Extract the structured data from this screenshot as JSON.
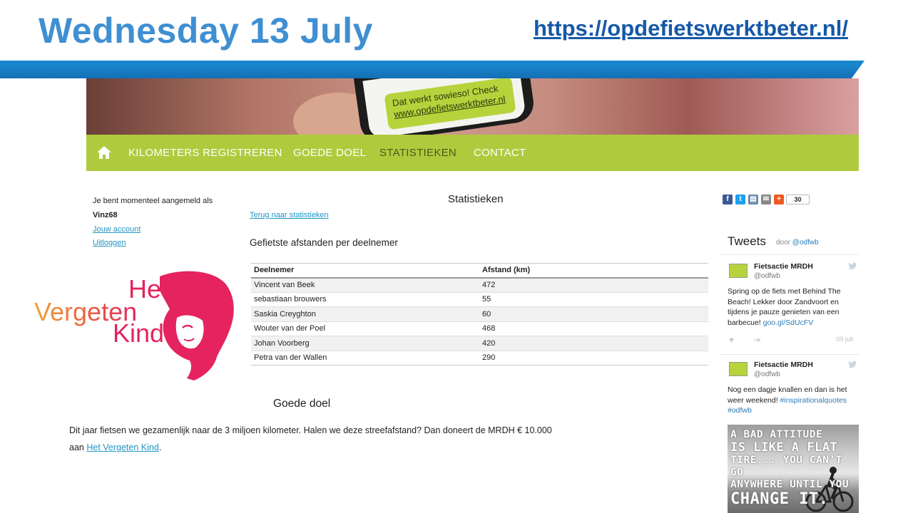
{
  "slide": {
    "title": "Wednesday 13 July",
    "url": "https://opdefietswerktbeter.nl/"
  },
  "hero": {
    "bubble_line1": "Dat werkt sowieso! Check",
    "bubble_line2": "www.opdefietswerktbeter.nl"
  },
  "nav": {
    "items": [
      "KILOMETERS REGISTREREN",
      "GOEDE DOEL",
      "STATISTIEKEN",
      "CONTACT"
    ],
    "active": "STATISTIEKEN"
  },
  "login": {
    "text": "Je bent momenteel aangemeld als",
    "user": "Vinz68",
    "account_link": "Jouw account",
    "logout_link": "Uitloggen"
  },
  "logo": {
    "line1": "Het",
    "line2": "Vergeten",
    "line3": "Kind"
  },
  "stats": {
    "title": "Statistieken",
    "back_link": "Terug naar statistieken",
    "subtitle": "Gefietste afstanden per deelnemer",
    "headers": [
      "Deelnemer",
      "Afstand (km)"
    ],
    "rows": [
      [
        "Vincent van Beek",
        "472"
      ],
      [
        "sebastiaan brouwers",
        "55"
      ],
      [
        "Saskia Creyghton",
        "60"
      ],
      [
        "Wouter van der Poel",
        "468"
      ],
      [
        "Johan Voorberg",
        "420"
      ],
      [
        "Petra van der Wallen",
        "290"
      ]
    ]
  },
  "goal": {
    "title": "Goede doel",
    "text_part1": "Dit jaar fietsen we gezamenlijk naar de 3 miljoen kilometer. Halen we deze streefafstand? Dan doneert de MRDH € 10.000 aan ",
    "link": "Het Vergeten Kind",
    "text_part2": "."
  },
  "share": {
    "count": "30",
    "colors": {
      "facebook": "#3b5998",
      "twitter": "#1da1f2",
      "print": "#6d8aa6",
      "email": "#888888",
      "plus": "#ee5a24"
    }
  },
  "tweets": {
    "title": "Tweets",
    "by_prefix": "door",
    "by_handle": "@odfwb",
    "items": [
      {
        "name": "Fietsactie MRDH",
        "handle": "@odfwb",
        "text": "Spring op de fiets met Behind The Beach! Lekker door Zandvoort en tijdens je pauze genieten van een barbecue!",
        "link": "goo.gl/SdUcFV",
        "date": "09 juli"
      },
      {
        "name": "Fietsactie MRDH",
        "handle": "@odfwb",
        "text": "Nog een dagje knallen en dan is het weer weekend!",
        "link": "#inspirationalquotes #odfwb"
      }
    ],
    "quote_image": {
      "line1": "A BAD ATTITUDE",
      "line2": "IS LIKE A FLAT",
      "line3": "TIRE... YOU CAN'T GO",
      "line4": "ANYWHERE UNTIL YOU",
      "line5": "CHANGE IT."
    }
  },
  "colors": {
    "title_blue": "#3f8fd2",
    "url_blue": "#1559a8",
    "band_blue": "#1b8ad3",
    "nav_green": "#afcb3d",
    "link_blue": "#2196c4",
    "logo_orange": "#f08a3c",
    "logo_pink": "#e4235f"
  }
}
